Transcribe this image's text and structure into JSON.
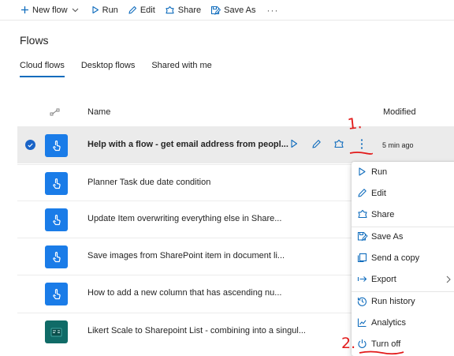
{
  "toolbar": {
    "new_flow": "New flow",
    "run": "Run",
    "edit": "Edit",
    "share": "Share",
    "save_as": "Save As",
    "more": "···"
  },
  "page_title": "Flows",
  "tabs": [
    {
      "label": "Cloud flows",
      "active": true
    },
    {
      "label": "Desktop flows",
      "active": false
    },
    {
      "label": "Shared with me",
      "active": false
    }
  ],
  "table": {
    "col_name": "Name",
    "col_modified": "Modified",
    "rows": [
      {
        "name": "Help with a flow - get email address from peopl...",
        "modified": "5 min ago",
        "selected": true,
        "icon": "touch-icon"
      },
      {
        "name": "Planner Task due date condition",
        "modified": "",
        "selected": false,
        "icon": "touch-icon"
      },
      {
        "name": "Update Item overwriting everything else in Share...",
        "modified": "",
        "selected": false,
        "icon": "touch-icon"
      },
      {
        "name": "Save images from SharePoint item in document li...",
        "modified": "",
        "selected": false,
        "icon": "touch-icon"
      },
      {
        "name": "How to add a new column that has ascending nu...",
        "modified": "",
        "selected": false,
        "icon": "touch-icon"
      },
      {
        "name": "Likert Scale to Sharepoint List - combining into a singul...",
        "modified": "",
        "selected": false,
        "icon": "forms-icon"
      }
    ]
  },
  "menu": {
    "items": [
      {
        "label": "Run",
        "icon": "play-icon"
      },
      {
        "label": "Edit",
        "icon": "pencil-icon"
      },
      {
        "label": "Share",
        "icon": "share-icon"
      },
      {
        "label": "Save As",
        "icon": "save-as-icon"
      },
      {
        "label": "Send a copy",
        "icon": "send-copy-icon"
      },
      {
        "label": "Export",
        "icon": "export-icon"
      },
      {
        "label": "Run history",
        "icon": "history-icon"
      },
      {
        "label": "Analytics",
        "icon": "analytics-icon"
      },
      {
        "label": "Turn off",
        "icon": "power-icon"
      }
    ]
  },
  "annotations": {
    "step1": "1.",
    "step2": "2."
  },
  "colors": {
    "accent": "#0f6cbd",
    "flow_icon": "#1a7ce8",
    "forms_icon": "#106b67",
    "annotation": "#e21a1a",
    "selected_row": "#ebebeb"
  }
}
